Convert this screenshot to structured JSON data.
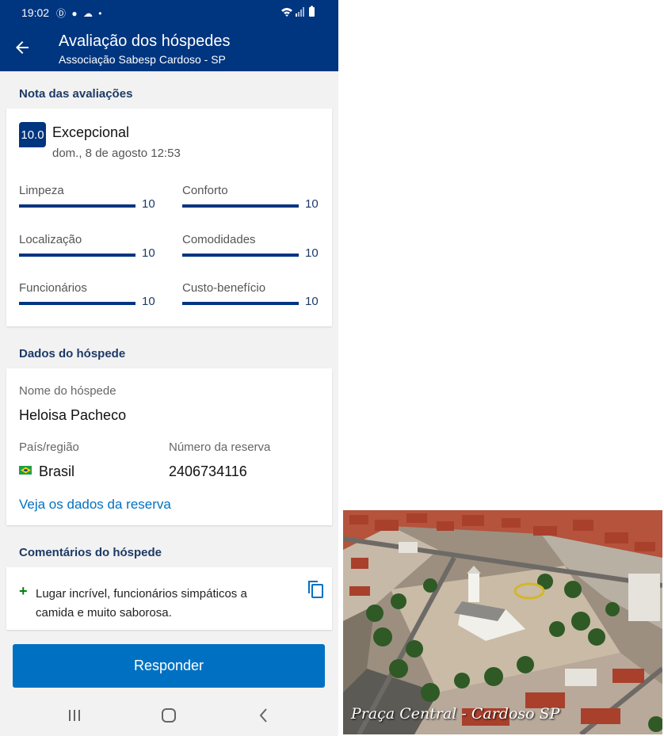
{
  "status_bar": {
    "time": "19:02",
    "icons": [
      "sync-icon",
      "facebook-icon",
      "weather-icon",
      "dot-icon",
      "wifi-icon",
      "signal-icon",
      "battery-icon"
    ]
  },
  "header": {
    "title": "Avaliação dos hóspedes",
    "subtitle": "Associação Sabesp Cardoso - SP"
  },
  "ratings": {
    "section_title": "Nota das avaliações",
    "score": "10.0",
    "score_label": "Excepcional",
    "date": "dom., 8 de agosto 12:53",
    "metrics": [
      {
        "label": "Limpeza",
        "value": "10",
        "fraction": 1.0
      },
      {
        "label": "Conforto",
        "value": "10",
        "fraction": 1.0
      },
      {
        "label": "Localização",
        "value": "10",
        "fraction": 1.0
      },
      {
        "label": "Comodidades",
        "value": "10",
        "fraction": 1.0
      },
      {
        "label": "Funcionários",
        "value": "10",
        "fraction": 1.0
      },
      {
        "label": "Custo-benefício",
        "value": "10",
        "fraction": 1.0
      }
    ]
  },
  "guest": {
    "section_title": "Dados do hóspede",
    "name_label": "Nome do hóspede",
    "name": "Heloisa Pacheco",
    "country_label": "País/região",
    "country": "Brasil",
    "reservation_label": "Número da reserva",
    "reservation": "2406734116",
    "link": "Veja os dados da reserva"
  },
  "comments": {
    "section_title": "Comentários do hóspede",
    "positive": "Lugar incrível, funcionários simpáticos a camida e muito saborosa."
  },
  "reply_button": "Responder",
  "photo": {
    "caption": "Praça Central - Cardoso SP"
  },
  "colors": {
    "brand": "#003580",
    "action": "#0071c2",
    "positive": "#008009"
  }
}
